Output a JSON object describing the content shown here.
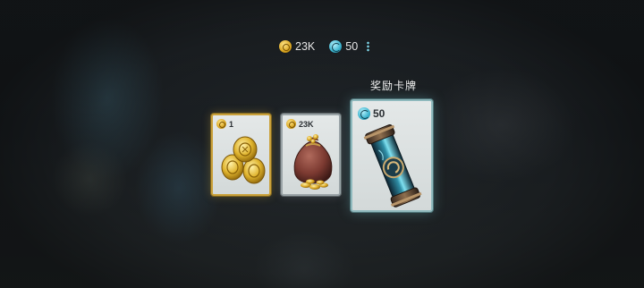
{
  "currency": {
    "coins_value": "23K",
    "orbs_value": "50"
  },
  "rewards": {
    "title": "奖励卡牌",
    "cards": [
      {
        "item": "gold-coins",
        "quantity": "1"
      },
      {
        "item": "coin-bag",
        "quantity": "23K"
      },
      {
        "item": "crystal-canister",
        "quantity": "50"
      }
    ]
  },
  "colors": {
    "gold_frame": "#caa13a",
    "silver_frame": "#9aa3a6",
    "teal_frame": "#8fb9bd",
    "card_bg": "#e4e8e8"
  }
}
